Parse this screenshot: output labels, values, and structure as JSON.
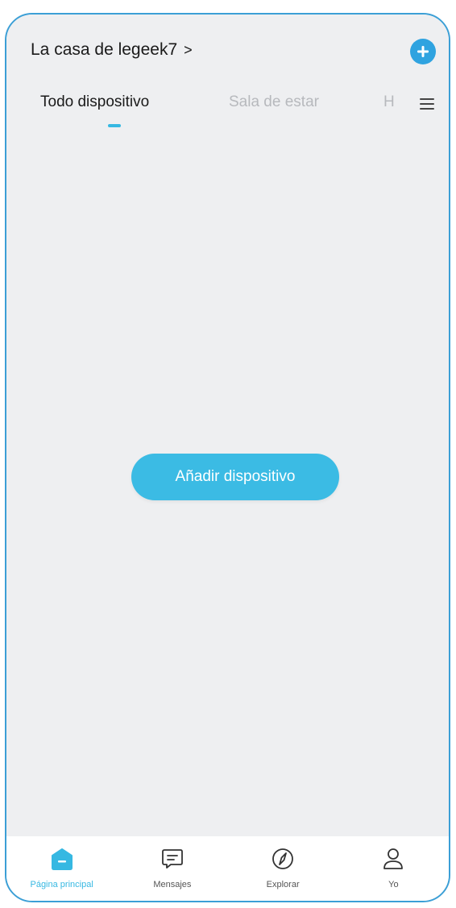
{
  "header": {
    "home_title": "La casa de legeek7",
    "home_chevron": ">",
    "add_icon": "plus-circle-icon"
  },
  "tabs": [
    {
      "label": "Todo dispositivo",
      "active": true
    },
    {
      "label": "Sala de estar",
      "active": false
    },
    {
      "label": "H",
      "active": false
    }
  ],
  "main": {
    "add_device_label": "Añadir dispositivo"
  },
  "tabbar": [
    {
      "label": "Página principal",
      "icon": "home-icon",
      "active": true
    },
    {
      "label": "Mensajes",
      "icon": "message-icon",
      "active": false
    },
    {
      "label": "Explorar",
      "icon": "compass-icon",
      "active": false
    },
    {
      "label": "Yo",
      "icon": "user-icon",
      "active": false
    }
  ],
  "colors": {
    "accent": "#36b8e2",
    "background": "#eeeff1",
    "frame": "#3b9fd6"
  }
}
